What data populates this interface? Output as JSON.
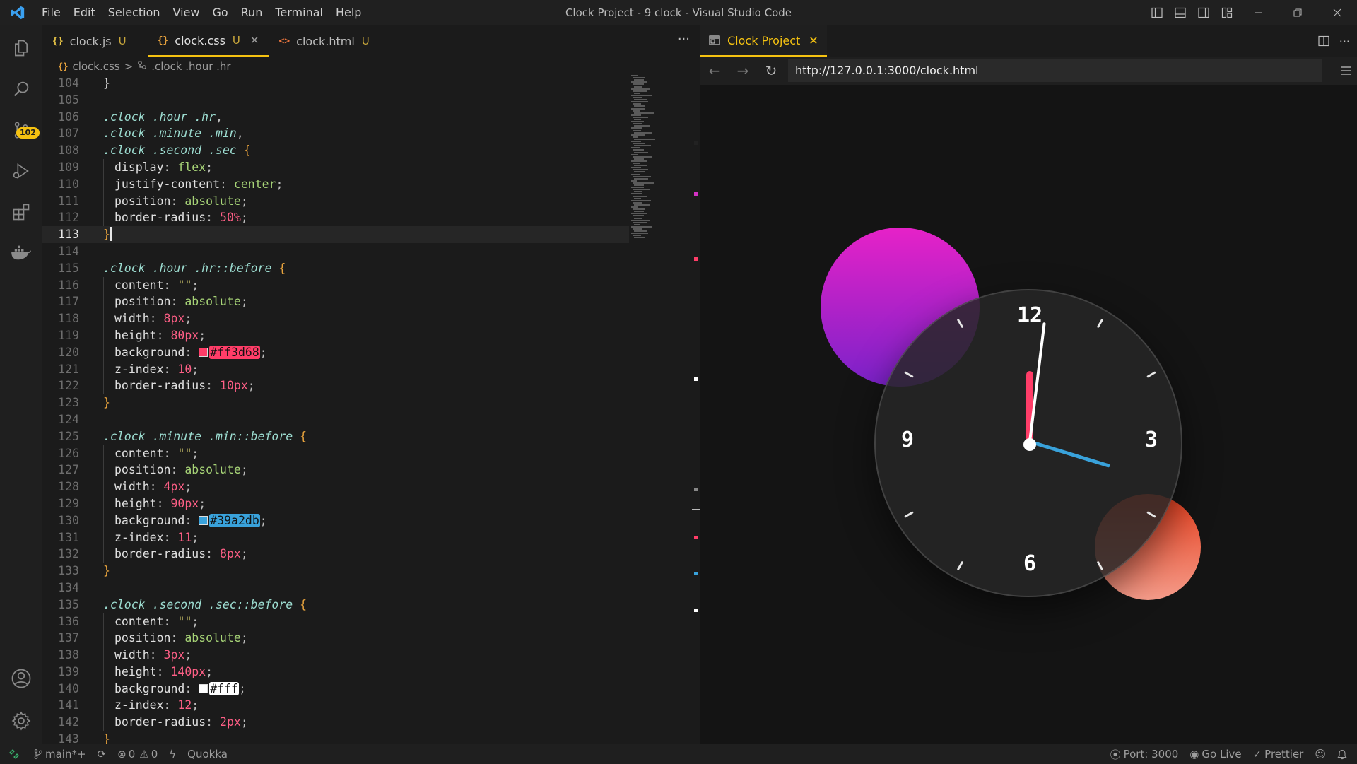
{
  "window": {
    "title": "Clock Project - 9 clock - Visual Studio Code",
    "menu": [
      "File",
      "Edit",
      "Selection",
      "View",
      "Go",
      "Run",
      "Terminal",
      "Help"
    ]
  },
  "activity_bar": {
    "icons": [
      "explorer-icon",
      "search-icon",
      "source-control-icon",
      "run-debug-icon",
      "extensions-icon",
      "docker-icon",
      "account-icon",
      "settings-icon"
    ],
    "source_control_badge": "102"
  },
  "editor": {
    "tabs": [
      {
        "icon": "{}",
        "label": "clock.js",
        "status": "U",
        "icon_color": "#e8c547"
      },
      {
        "icon": "{}",
        "label": "clock.css",
        "status": "U",
        "icon_color": "#e8a33d",
        "active": true
      },
      {
        "icon": "<>",
        "label": "clock.html",
        "status": "U",
        "icon_color": "#e8743d"
      }
    ],
    "more": "···",
    "breadcrumb": {
      "file": "clock.css",
      "separator": ">",
      "symbol": ".clock .hour .hr"
    },
    "current_line": 113,
    "lines": [
      {
        "n": "104",
        "tokens": [
          [
            "tk-brace2",
            "}"
          ]
        ]
      },
      {
        "n": "105",
        "tokens": []
      },
      {
        "n": "106",
        "tokens": [
          [
            "tk-sel",
            ".clock .hour .hr"
          ],
          [
            "tk-punc",
            ","
          ]
        ]
      },
      {
        "n": "107",
        "tokens": [
          [
            "tk-sel",
            ".clock .minute .min"
          ],
          [
            "tk-punc",
            ","
          ]
        ]
      },
      {
        "n": "108",
        "tokens": [
          [
            "tk-sel",
            ".clock .second .sec"
          ],
          [
            "tk-punc",
            " "
          ],
          [
            "tk-brace",
            "{"
          ]
        ]
      },
      {
        "n": "109",
        "indent": true,
        "tokens": [
          [
            "tk-prop",
            "display"
          ],
          [
            "tk-punc",
            ": "
          ],
          [
            "tk-val",
            "flex"
          ],
          [
            "tk-punc",
            ";"
          ]
        ]
      },
      {
        "n": "110",
        "indent": true,
        "tokens": [
          [
            "tk-prop",
            "justify-content"
          ],
          [
            "tk-punc",
            ": "
          ],
          [
            "tk-val",
            "center"
          ],
          [
            "tk-punc",
            ";"
          ]
        ]
      },
      {
        "n": "111",
        "indent": true,
        "tokens": [
          [
            "tk-prop",
            "position"
          ],
          [
            "tk-punc",
            ": "
          ],
          [
            "tk-val",
            "absolute"
          ],
          [
            "tk-punc",
            ";"
          ]
        ]
      },
      {
        "n": "112",
        "indent": true,
        "tokens": [
          [
            "tk-prop",
            "border-radius"
          ],
          [
            "tk-punc",
            ": "
          ],
          [
            "tk-num",
            "50%"
          ],
          [
            "tk-punc",
            ";"
          ]
        ]
      },
      {
        "n": "113",
        "current": true,
        "tokens": [
          [
            "tk-brace",
            "}"
          ],
          [
            "cursor",
            ""
          ]
        ]
      },
      {
        "n": "114",
        "tokens": []
      },
      {
        "n": "115",
        "tokens": [
          [
            "tk-sel",
            ".clock .hour .hr::before"
          ],
          [
            "tk-punc",
            " "
          ],
          [
            "tk-brace",
            "{"
          ]
        ]
      },
      {
        "n": "116",
        "indent": true,
        "tokens": [
          [
            "tk-prop",
            "content"
          ],
          [
            "tk-punc",
            ": "
          ],
          [
            "tk-str",
            "\"\""
          ],
          [
            "tk-punc",
            ";"
          ]
        ]
      },
      {
        "n": "117",
        "indent": true,
        "tokens": [
          [
            "tk-prop",
            "position"
          ],
          [
            "tk-punc",
            ": "
          ],
          [
            "tk-val",
            "absolute"
          ],
          [
            "tk-punc",
            ";"
          ]
        ]
      },
      {
        "n": "118",
        "indent": true,
        "tokens": [
          [
            "tk-prop",
            "width"
          ],
          [
            "tk-punc",
            ": "
          ],
          [
            "tk-num",
            "8px"
          ],
          [
            "tk-punc",
            ";"
          ]
        ]
      },
      {
        "n": "119",
        "indent": true,
        "tokens": [
          [
            "tk-prop",
            "height"
          ],
          [
            "tk-punc",
            ": "
          ],
          [
            "tk-num",
            "80px"
          ],
          [
            "tk-punc",
            ";"
          ]
        ]
      },
      {
        "n": "120",
        "indent": true,
        "tokens": [
          [
            "tk-prop",
            "background"
          ],
          [
            "tk-punc",
            ": "
          ],
          [
            "color",
            "#ff3d68"
          ],
          [
            "tk-punc",
            ";"
          ]
        ]
      },
      {
        "n": "121",
        "indent": true,
        "tokens": [
          [
            "tk-prop",
            "z-index"
          ],
          [
            "tk-punc",
            ": "
          ],
          [
            "tk-num",
            "10"
          ],
          [
            "tk-punc",
            ";"
          ]
        ]
      },
      {
        "n": "122",
        "indent": true,
        "tokens": [
          [
            "tk-prop",
            "border-radius"
          ],
          [
            "tk-punc",
            ": "
          ],
          [
            "tk-num",
            "10px"
          ],
          [
            "tk-punc",
            ";"
          ]
        ]
      },
      {
        "n": "123",
        "tokens": [
          [
            "tk-brace",
            "}"
          ]
        ]
      },
      {
        "n": "124",
        "tokens": []
      },
      {
        "n": "125",
        "tokens": [
          [
            "tk-sel",
            ".clock .minute .min::before"
          ],
          [
            "tk-punc",
            " "
          ],
          [
            "tk-brace",
            "{"
          ]
        ]
      },
      {
        "n": "126",
        "indent": true,
        "tokens": [
          [
            "tk-prop",
            "content"
          ],
          [
            "tk-punc",
            ": "
          ],
          [
            "tk-str",
            "\"\""
          ],
          [
            "tk-punc",
            ";"
          ]
        ]
      },
      {
        "n": "127",
        "indent": true,
        "tokens": [
          [
            "tk-prop",
            "position"
          ],
          [
            "tk-punc",
            ": "
          ],
          [
            "tk-val",
            "absolute"
          ],
          [
            "tk-punc",
            ";"
          ]
        ]
      },
      {
        "n": "128",
        "indent": true,
        "tokens": [
          [
            "tk-prop",
            "width"
          ],
          [
            "tk-punc",
            ": "
          ],
          [
            "tk-num",
            "4px"
          ],
          [
            "tk-punc",
            ";"
          ]
        ]
      },
      {
        "n": "129",
        "indent": true,
        "tokens": [
          [
            "tk-prop",
            "height"
          ],
          [
            "tk-punc",
            ": "
          ],
          [
            "tk-num",
            "90px"
          ],
          [
            "tk-punc",
            ";"
          ]
        ]
      },
      {
        "n": "130",
        "indent": true,
        "tokens": [
          [
            "tk-prop",
            "background"
          ],
          [
            "tk-punc",
            ": "
          ],
          [
            "color",
            "#39a2db"
          ],
          [
            "tk-punc",
            ";"
          ]
        ]
      },
      {
        "n": "131",
        "indent": true,
        "tokens": [
          [
            "tk-prop",
            "z-index"
          ],
          [
            "tk-punc",
            ": "
          ],
          [
            "tk-num",
            "11"
          ],
          [
            "tk-punc",
            ";"
          ]
        ]
      },
      {
        "n": "132",
        "indent": true,
        "tokens": [
          [
            "tk-prop",
            "border-radius"
          ],
          [
            "tk-punc",
            ": "
          ],
          [
            "tk-num",
            "8px"
          ],
          [
            "tk-punc",
            ";"
          ]
        ]
      },
      {
        "n": "133",
        "tokens": [
          [
            "tk-brace",
            "}"
          ]
        ]
      },
      {
        "n": "134",
        "tokens": []
      },
      {
        "n": "135",
        "tokens": [
          [
            "tk-sel",
            ".clock .second .sec::before"
          ],
          [
            "tk-punc",
            " "
          ],
          [
            "tk-brace",
            "{"
          ]
        ]
      },
      {
        "n": "136",
        "indent": true,
        "tokens": [
          [
            "tk-prop",
            "content"
          ],
          [
            "tk-punc",
            ": "
          ],
          [
            "tk-str",
            "\"\""
          ],
          [
            "tk-punc",
            ";"
          ]
        ]
      },
      {
        "n": "137",
        "indent": true,
        "tokens": [
          [
            "tk-prop",
            "position"
          ],
          [
            "tk-punc",
            ": "
          ],
          [
            "tk-val",
            "absolute"
          ],
          [
            "tk-punc",
            ";"
          ]
        ]
      },
      {
        "n": "138",
        "indent": true,
        "tokens": [
          [
            "tk-prop",
            "width"
          ],
          [
            "tk-punc",
            ": "
          ],
          [
            "tk-num",
            "3px"
          ],
          [
            "tk-punc",
            ";"
          ]
        ]
      },
      {
        "n": "139",
        "indent": true,
        "tokens": [
          [
            "tk-prop",
            "height"
          ],
          [
            "tk-punc",
            ": "
          ],
          [
            "tk-num",
            "140px"
          ],
          [
            "tk-punc",
            ";"
          ]
        ]
      },
      {
        "n": "140",
        "indent": true,
        "tokens": [
          [
            "tk-prop",
            "background"
          ],
          [
            "tk-punc",
            ": "
          ],
          [
            "color",
            "#fff"
          ],
          [
            "tk-punc",
            ";"
          ]
        ]
      },
      {
        "n": "141",
        "indent": true,
        "tokens": [
          [
            "tk-prop",
            "z-index"
          ],
          [
            "tk-punc",
            ": "
          ],
          [
            "tk-num",
            "12"
          ],
          [
            "tk-punc",
            ";"
          ]
        ]
      },
      {
        "n": "142",
        "indent": true,
        "tokens": [
          [
            "tk-prop",
            "border-radius"
          ],
          [
            "tk-punc",
            ": "
          ],
          [
            "tk-num",
            "2px"
          ],
          [
            "tk-punc",
            ";"
          ]
        ]
      },
      {
        "n": "143",
        "tokens": [
          [
            "tk-brace",
            "}"
          ]
        ]
      }
    ]
  },
  "browser": {
    "tab_label": "Clock Project",
    "tab_close": "✕",
    "url": "http://127.0.0.1:3000/clock.html",
    "clock": {
      "numbers": [
        "12",
        "3",
        "6",
        "9"
      ],
      "hour_color": "#ff3d68",
      "minute_color": "#39a2db",
      "second_color": "#ffffff",
      "hour_hand_angle_deg": 0,
      "minute_hand_angle_deg": 107,
      "second_hand_angle_deg": 7
    }
  },
  "statusbar": {
    "branch": "main*+",
    "errors": "0",
    "warnings": "0",
    "quokka": "Quokka",
    "port": "Port: 3000",
    "go_live": "Go Live",
    "prettier": "Prettier"
  }
}
